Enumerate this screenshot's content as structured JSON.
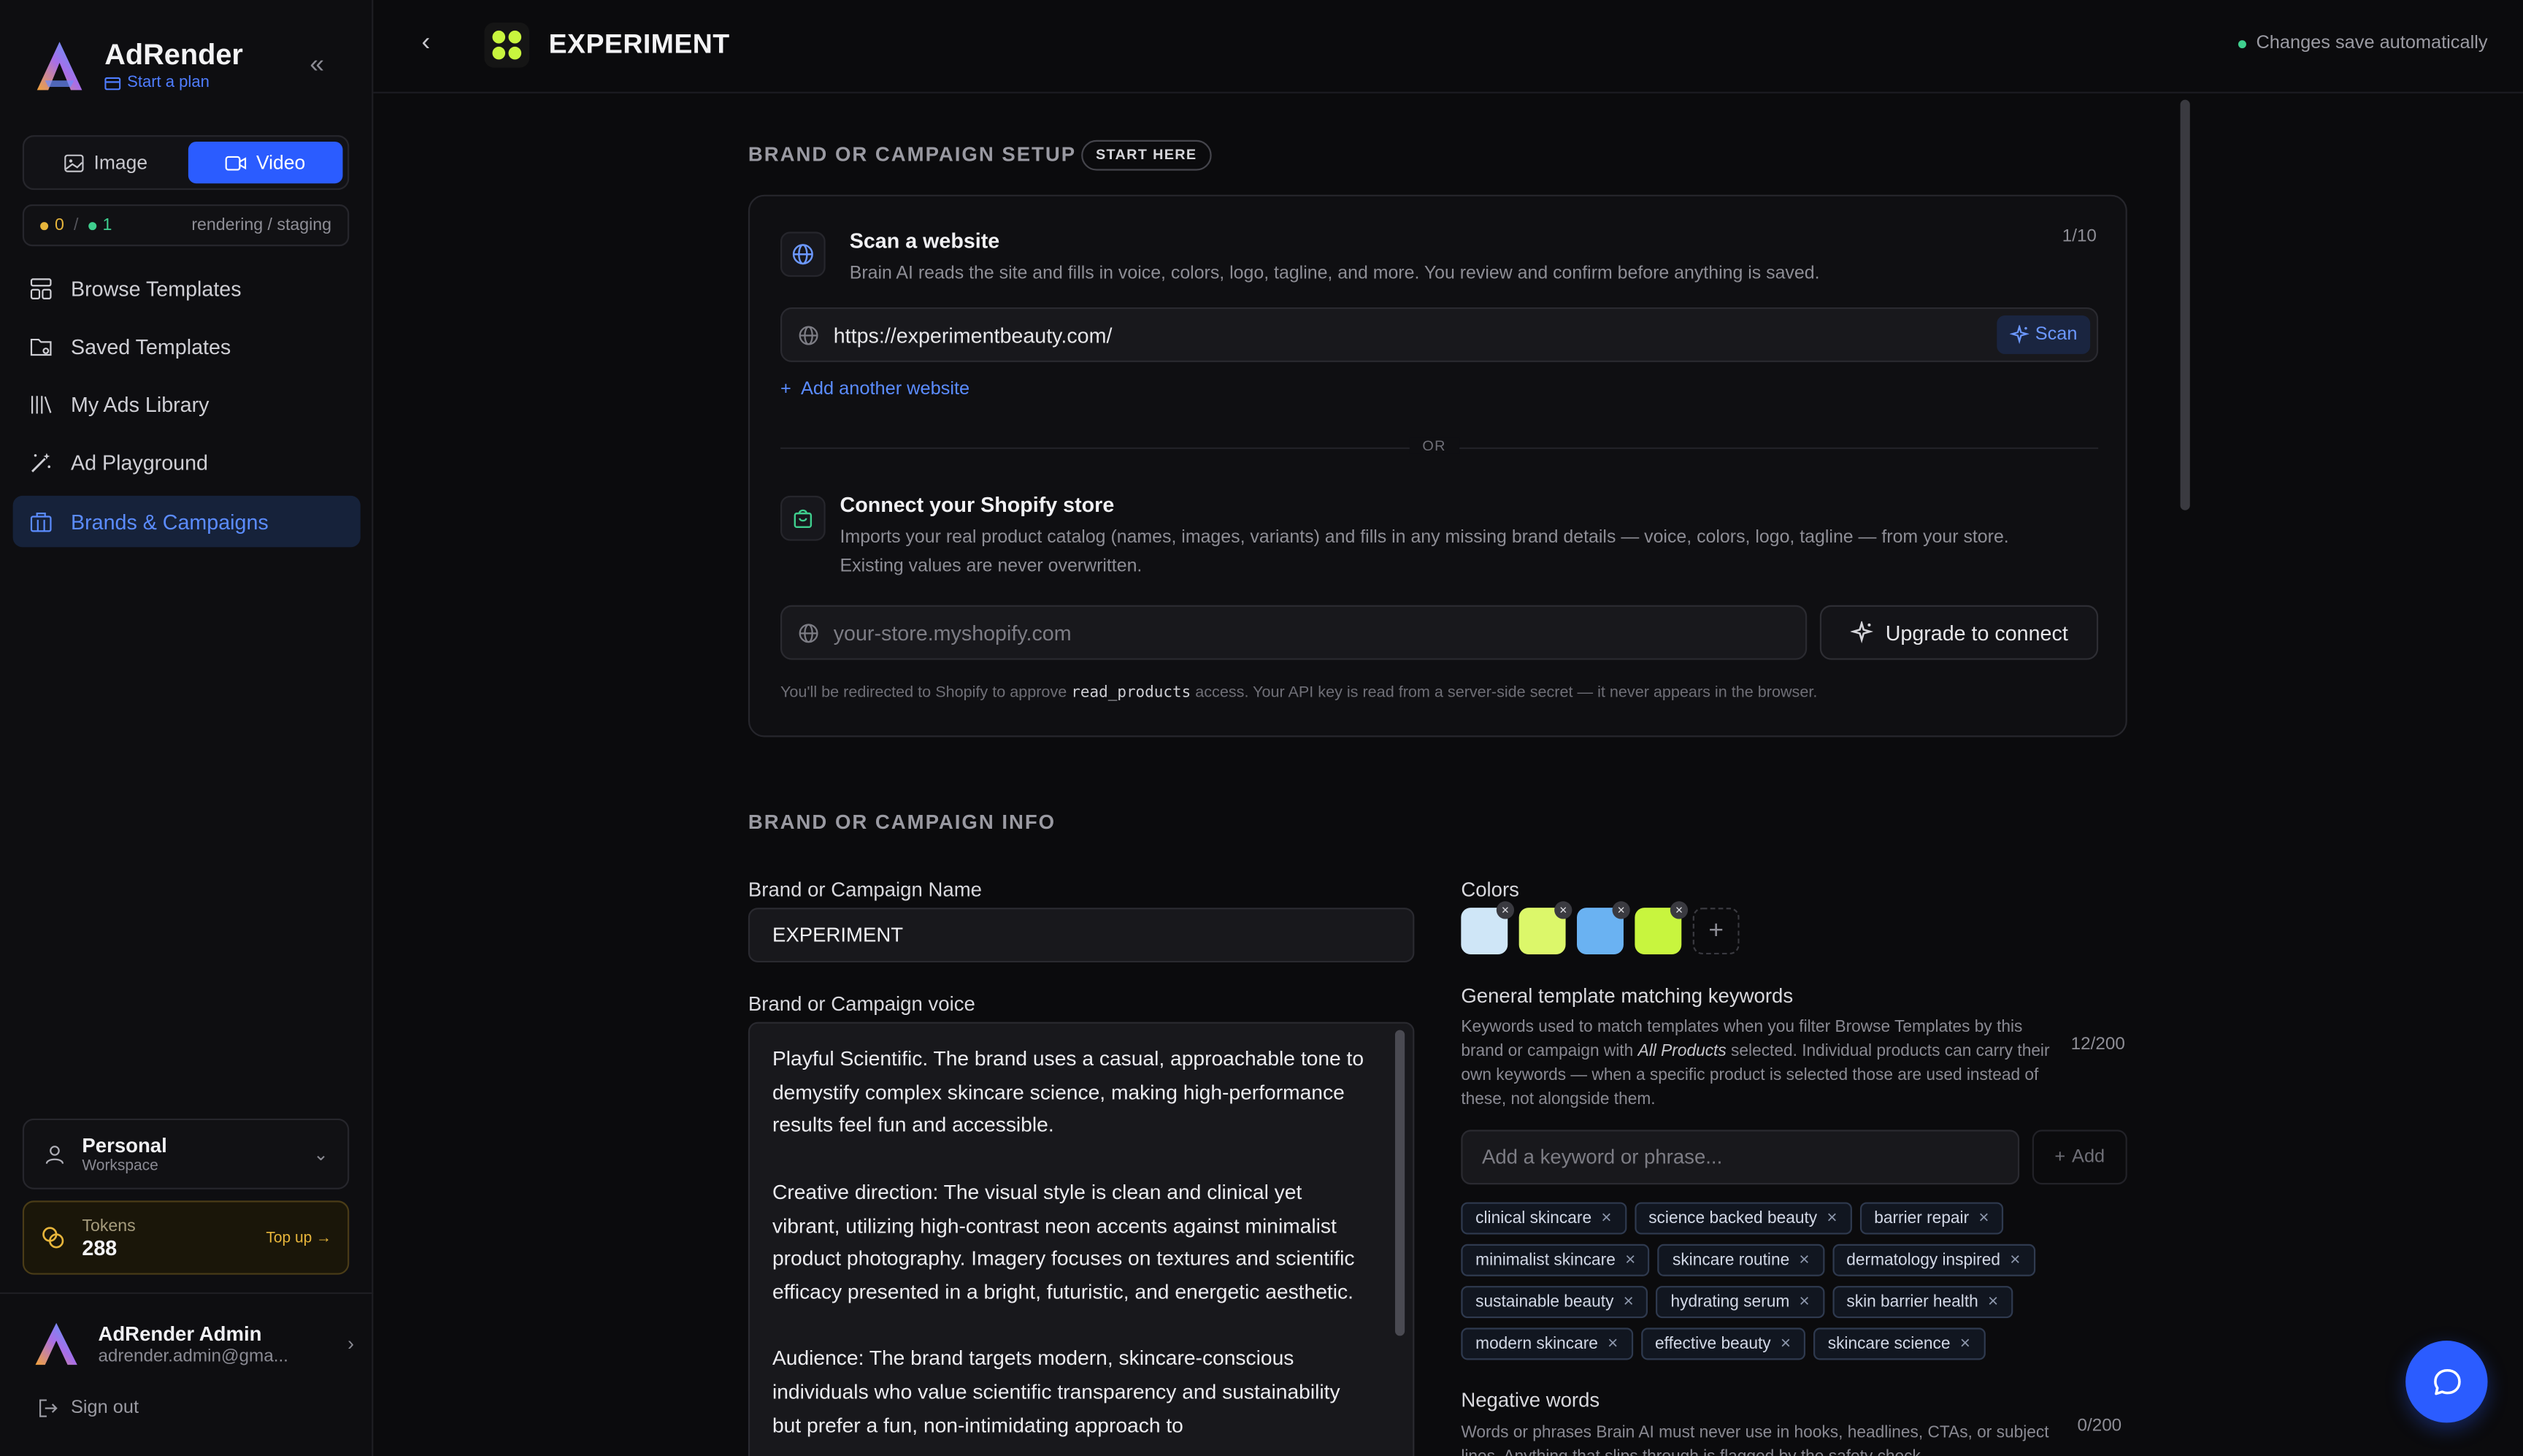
{
  "app": {
    "name": "AdRender",
    "plan_link": "Start a plan"
  },
  "sidebar": {
    "mode_tabs": [
      {
        "label": "Image",
        "active": false
      },
      {
        "label": "Video",
        "active": true
      }
    ],
    "status": {
      "pending": "0",
      "separator": "/",
      "done": "1",
      "label": "rendering / staging"
    },
    "nav": [
      {
        "label": "Browse Templates",
        "icon": "layout-icon"
      },
      {
        "label": "Saved Templates",
        "icon": "folder-icon"
      },
      {
        "label": "My Ads Library",
        "icon": "library-icon"
      },
      {
        "label": "Ad Playground",
        "icon": "magic-wand-icon"
      },
      {
        "label": "Brands & Campaigns",
        "icon": "briefcase-icon",
        "active": true
      }
    ],
    "workspace": {
      "title": "Personal",
      "subtitle": "Workspace"
    },
    "tokens": {
      "label": "Tokens",
      "value": "288",
      "topup": "Top up →"
    },
    "user": {
      "name": "AdRender Admin",
      "email": "adrender.admin@gma..."
    },
    "signout": "Sign out"
  },
  "header": {
    "title": "EXPERIMENT",
    "autosave": "Changes save automatically"
  },
  "setup": {
    "heading": "BRAND OR CAMPAIGN SETUP",
    "badge": "START HERE",
    "scan": {
      "title": "Scan a website",
      "description": "Brain AI reads the site and fills in voice, colors, logo, tagline, and more. You review and confirm before anything is saved.",
      "counter": "1/10",
      "url": "https://experimentbeauty.com/",
      "scan_label": "Scan",
      "add_another": "Add another website"
    },
    "or": "OR",
    "shopify": {
      "title": "Connect your Shopify store",
      "description_line1": "Imports your real product catalog (names, images, variants) and fills in any missing brand details — voice, colors, logo, tagline — from your store.",
      "description_line2": "Existing values are never overwritten.",
      "placeholder": "your-store.myshopify.com",
      "upgrade_label": "Upgrade to connect",
      "redirect_pre": "You'll be redirected to Shopify to approve",
      "redirect_code": "read_products",
      "redirect_post": "access. Your API key is read from a server-side secret — it never appears in the browser."
    }
  },
  "info": {
    "heading": "BRAND OR CAMPAIGN INFO",
    "name_label": "Brand or Campaign Name",
    "name_value": "EXPERIMENT",
    "voice_label": "Brand or Campaign voice",
    "voice_paragraphs": [
      "Playful Scientific. The brand uses a casual, approachable tone to demystify complex skincare science, making high-performance results feel fun and accessible.",
      "Creative direction: The visual style is clean and clinical yet vibrant, utilizing high-contrast neon accents against minimalist product photography. Imagery focuses on textures and scientific efficacy presented in a bright, futuristic, and energetic aesthetic.",
      "Audience: The brand targets modern, skincare-conscious individuals who value scientific transparency and sustainability but prefer a fun, non-intimidating approach to"
    ],
    "colors_label": "Colors",
    "colors": [
      "#cfe6f7",
      "#dcf76a",
      "#6ab2f2",
      "#c8f53e"
    ],
    "keywords": {
      "title": "General template matching keywords",
      "desc_pre": "Keywords used to match templates when you filter Browse Templates by this brand or campaign with",
      "desc_em": "All Products",
      "desc_post": "selected. Individual products can carry their own keywords — when a specific product is selected those are used instead of these, not alongside them.",
      "counter": "12/200",
      "placeholder": "Add a keyword or phrase...",
      "add_label": "Add",
      "items": [
        "clinical skincare",
        "science backed beauty",
        "barrier repair",
        "minimalist skincare",
        "skincare routine",
        "dermatology inspired",
        "sustainable beauty",
        "hydrating serum",
        "skin barrier health",
        "modern skincare",
        "effective beauty",
        "skincare science"
      ]
    },
    "negative": {
      "title": "Negative words",
      "counter": "0/200",
      "desc": "Words or phrases Brain AI must never use in hooks, headlines, CTAs, or subject lines. Anything that slips through is flagged by the safety check."
    }
  }
}
